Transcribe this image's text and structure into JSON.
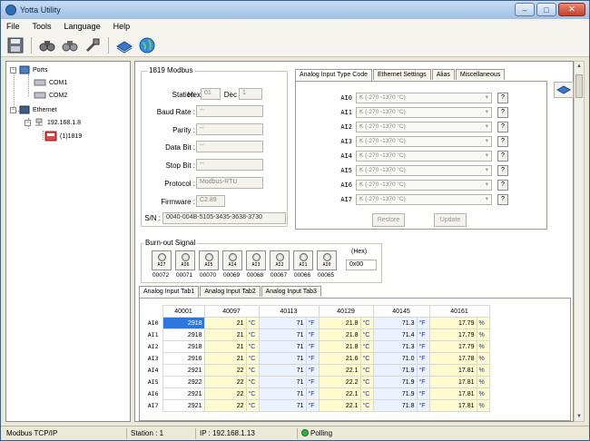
{
  "window": {
    "title": "Yotta Utility",
    "minimize": "–",
    "maximize": "□",
    "close": "✕"
  },
  "menu": [
    "File",
    "Tools",
    "Language",
    "Help"
  ],
  "toolbar": {
    "icons": [
      "save-icon",
      "search-device-icon",
      "search-device-2-icon",
      "connect-icon",
      "book-icon",
      "globe-icon"
    ]
  },
  "tree": {
    "ports": "Ports",
    "com1": "COM1",
    "com2": "COM2",
    "ethernet": "Ethernet",
    "ip": "192.168.1.8",
    "device": "(1)1819",
    "expanders": [
      "−",
      "−",
      "−"
    ]
  },
  "modbus": {
    "group_title": "1819 Modbus",
    "station_label": "Station :",
    "hex_label": "Hex",
    "hex_value": "01",
    "dec_label": "Dec",
    "dec_value": "1",
    "baud_label": "Baud Rate :",
    "baud_value": "--",
    "parity_label": "Parity :",
    "parity_value": "--",
    "databit_label": "Data Bit :",
    "databit_value": "--",
    "stopbit_label": "Stop Bit :",
    "stopbit_value": "--",
    "protocol_label": "Protocol :",
    "protocol_value": "Modbus-RTU",
    "firmware_label": "Firmware :",
    "firmware_value": "C2.89",
    "sn_label": "S/N :",
    "sn_value": "0040-004B-5105-3435-3638-3730"
  },
  "config_tabs": [
    "Analog Input Type Code",
    "Ethernet Settings",
    "Alias",
    "Miscellaneous"
  ],
  "analog_inputs": [
    {
      "name": "AI0",
      "type": "K (-270~1370 °C)"
    },
    {
      "name": "AI1",
      "type": "K (-270~1370 °C)"
    },
    {
      "name": "AI2",
      "type": "K (-270~1370 °C)"
    },
    {
      "name": "AI3",
      "type": "K (-270~1370 °C)"
    },
    {
      "name": "AI4",
      "type": "K (-270~1370 °C)"
    },
    {
      "name": "AI5",
      "type": "K (-270~1370 °C)"
    },
    {
      "name": "AI6",
      "type": "K (-270~1370 °C)"
    },
    {
      "name": "AI7",
      "type": "K (-270~1370 °C)"
    }
  ],
  "help_label": "?",
  "restore_label": "Restore",
  "update_label": "Update",
  "burnout": {
    "title": "Burn-out Signal",
    "labels": [
      "AI7",
      "AI6",
      "AI5",
      "AI4",
      "AI3",
      "AI2",
      "AI1",
      "AI0"
    ],
    "registers": [
      "00072",
      "00071",
      "00070",
      "00069",
      "00068",
      "00067",
      "00066",
      "00065"
    ],
    "hex_label": "(Hex)",
    "hex_value": "0x00"
  },
  "data_tabs": [
    "Analog Input Tab1",
    "Analog Input Tab2",
    "Analog Input Tab3"
  ],
  "table": {
    "headers": [
      "40001",
      "40097",
      "40113",
      "40129",
      "40145",
      "40161"
    ],
    "rows": [
      {
        "ch": "AI0",
        "c1": "2918",
        "c2": "21",
        "u2": "°C",
        "c3": "71",
        "u3": "°F",
        "c4": "21.8",
        "u4": "°C",
        "c5": "71.3",
        "u5": "°F",
        "c6": "17.79",
        "u6": "%"
      },
      {
        "ch": "AI1",
        "c1": "2918",
        "c2": "21",
        "u2": "°C",
        "c3": "71",
        "u3": "°F",
        "c4": "21.8",
        "u4": "°C",
        "c5": "71.4",
        "u5": "°F",
        "c6": "17.79",
        "u6": "%"
      },
      {
        "ch": "AI2",
        "c1": "2918",
        "c2": "21",
        "u2": "°C",
        "c3": "71",
        "u3": "°F",
        "c4": "21.8",
        "u4": "°C",
        "c5": "71.3",
        "u5": "°F",
        "c6": "17.79",
        "u6": "%"
      },
      {
        "ch": "AI3",
        "c1": "2916",
        "c2": "21",
        "u2": "°C",
        "c3": "71",
        "u3": "°F",
        "c4": "21.6",
        "u4": "°C",
        "c5": "71.0",
        "u5": "°F",
        "c6": "17.78",
        "u6": "%"
      },
      {
        "ch": "AI4",
        "c1": "2921",
        "c2": "22",
        "u2": "°C",
        "c3": "71",
        "u3": "°F",
        "c4": "22.1",
        "u4": "°C",
        "c5": "71.9",
        "u5": "°F",
        "c6": "17.81",
        "u6": "%"
      },
      {
        "ch": "AI5",
        "c1": "2922",
        "c2": "22",
        "u2": "°C",
        "c3": "71",
        "u3": "°F",
        "c4": "22.2",
        "u4": "°C",
        "c5": "71.9",
        "u5": "°F",
        "c6": "17.81",
        "u6": "%"
      },
      {
        "ch": "AI6",
        "c1": "2921",
        "c2": "22",
        "u2": "°C",
        "c3": "71",
        "u3": "°F",
        "c4": "22.1",
        "u4": "°C",
        "c5": "71.9",
        "u5": "°F",
        "c6": "17.81",
        "u6": "%"
      },
      {
        "ch": "AI7",
        "c1": "2921",
        "c2": "22",
        "u2": "°C",
        "c3": "71",
        "u3": "°F",
        "c4": "22.1",
        "u4": "°C",
        "c5": "71.8",
        "u5": "°F",
        "c6": "17.81",
        "u6": "%"
      }
    ]
  },
  "status": {
    "protocol": "Modbus TCP/IP",
    "station": "Station : 1",
    "ip": "IP : 192.168.1.13",
    "polling": "Polling"
  },
  "scroll_arrows": {
    "up": "▲",
    "down": "▼"
  },
  "colors": {
    "selected_cell": "#2e76e0",
    "polling_dot": "#2db33c",
    "unit_text": "#1c2fb3"
  }
}
